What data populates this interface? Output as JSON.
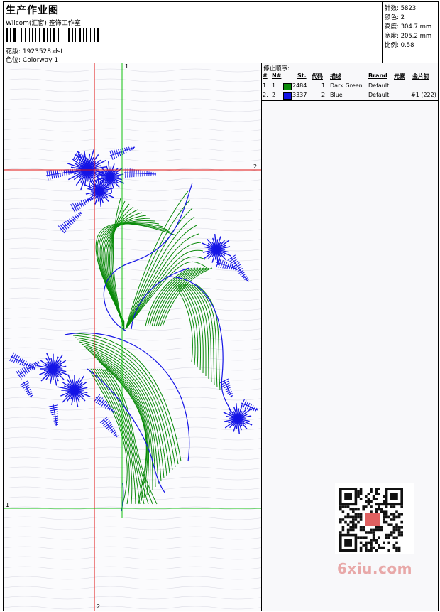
{
  "header": {
    "title": "生产作业图",
    "subtitle": "Wilcom(汇窗) 签饰工作室",
    "design_label": "花版:",
    "design_value": "1923528.dst",
    "colorway_label": "色位:",
    "colorway_value": "Colorway 1"
  },
  "stats": {
    "stitches_label": "针数:",
    "stitches_value": "5823",
    "colors_label": "颜色:",
    "colors_value": "2",
    "height_label": "高度:",
    "height_value": "304.7 mm",
    "width_label": "宽度:",
    "width_value": "205.2 mm",
    "scale_label": "比例:",
    "scale_value": "0.58"
  },
  "stop_sequence": {
    "title": "停止顺序:",
    "headers": [
      "#",
      "N#",
      "St.",
      "代码",
      "描述",
      "Brand",
      "元素",
      "金片钉"
    ],
    "rows": [
      {
        "index": "1.",
        "needle": "1",
        "color": "#0a8a0a",
        "stitches": "2484",
        "code": "1",
        "description": "Dark Green",
        "brand": "Default",
        "element": ""
      },
      {
        "index": "2.",
        "needle": "2",
        "color": "#1414e6",
        "stitches": "3337",
        "code": "2",
        "description": "Blue",
        "brand": "Default",
        "element": "#1 (222)"
      }
    ]
  },
  "guides": {
    "top_label": "1",
    "right_label": "2",
    "left_label": "1",
    "bottom_label": "2",
    "red_color": "#e01010",
    "green_color": "#10c010"
  },
  "watermark": "6xiu.com"
}
